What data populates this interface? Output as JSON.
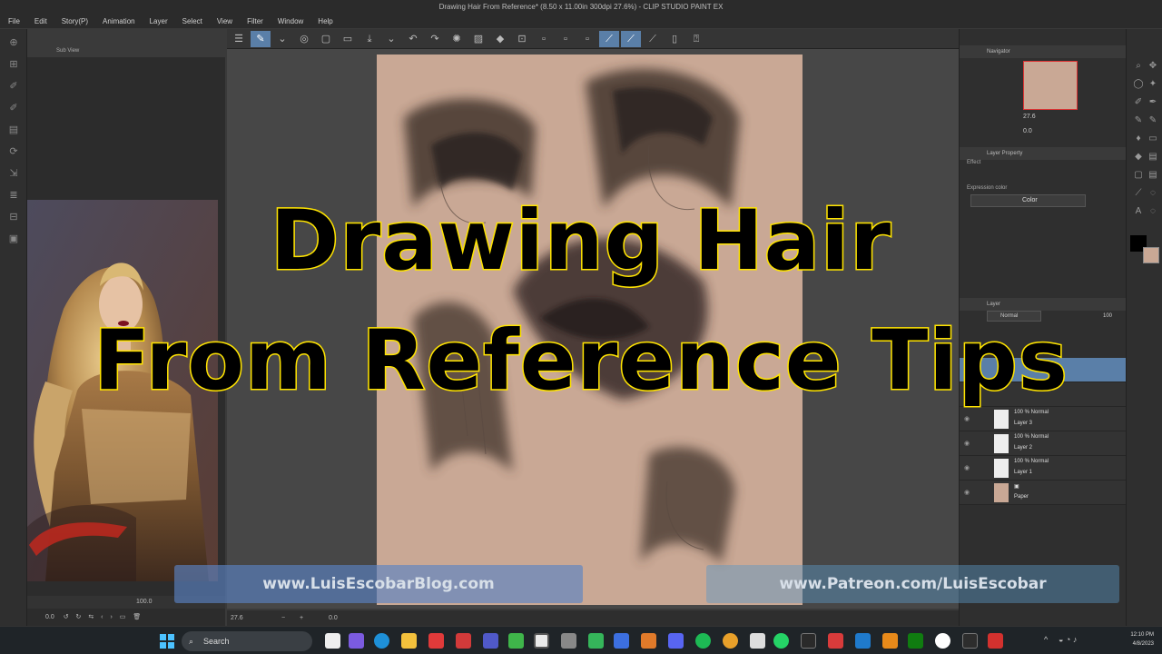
{
  "window": {
    "title": "Drawing Hair From Reference* (8.50 x 11.00in 300dpi 27.6%) - CLIP STUDIO PAINT EX"
  },
  "menu": [
    "File",
    "Edit",
    "Story(P)",
    "Animation",
    "Layer",
    "Select",
    "View",
    "Filter",
    "Window",
    "Help"
  ],
  "subview": {
    "tab_label": "Sub View",
    "zoom": "100.0",
    "angle": "0.0"
  },
  "canvas_status": {
    "zoom": "27.6",
    "angle": "0.0"
  },
  "navigator": {
    "tab_label": "Navigator",
    "zoom": "27.6",
    "angle": "0.0"
  },
  "layer_property": {
    "tab_label": "Layer Property",
    "effect_label": "Effect",
    "expression_color_label": "Expression color",
    "expression_color_value": "Color"
  },
  "layer_panel": {
    "tab_label": "Layer",
    "blend_mode": "Normal",
    "opacity": "100",
    "layers": [
      {
        "mode": "100 % Normal",
        "name": "Layer 3",
        "selected": false
      },
      {
        "mode": "100 % Normal",
        "name": "Layer 2",
        "selected": false
      },
      {
        "mode": "100 % Normal",
        "name": "Layer 1",
        "selected": false
      },
      {
        "mode": "",
        "name": "Paper",
        "selected": false
      }
    ]
  },
  "overlay": {
    "title_line1": "Drawing Hair",
    "title_line2": "From Reference Tips",
    "banner_left": "www.LuisEscobarBlog.com",
    "banner_right": "www.Patreon.com/LuisEscobar"
  },
  "taskbar": {
    "search_placeholder": "Search",
    "time": "12:10 PM",
    "date": "4/8/2023"
  },
  "colors": {
    "paper": "#c9a895",
    "accent": "#5a7fa8",
    "title_fill": "#000000",
    "title_stroke": "#ffe400"
  }
}
